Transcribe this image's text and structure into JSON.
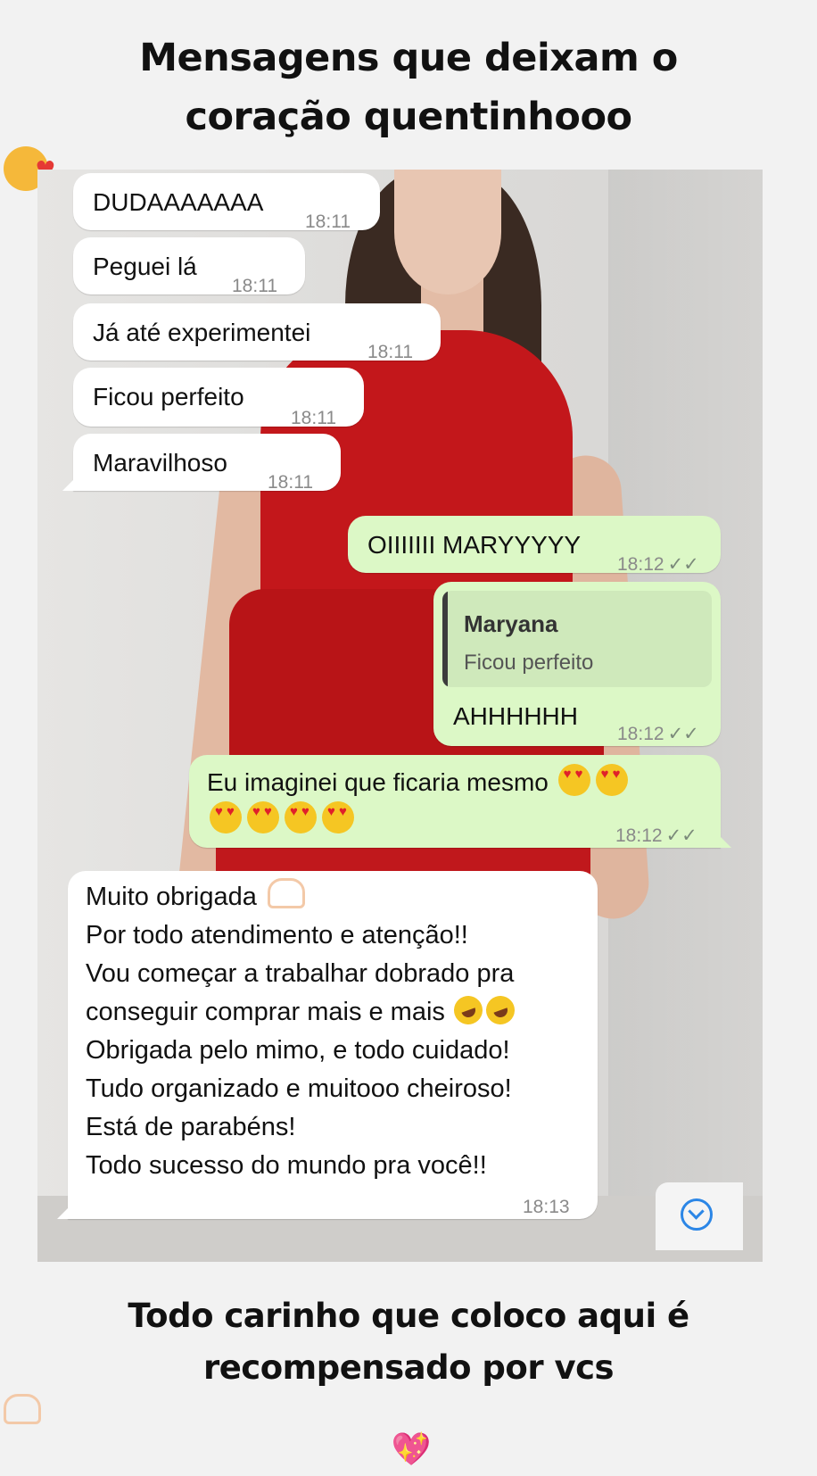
{
  "header": {
    "line1": "Mensagens que deixam o",
    "line2": "coração quentinhooo",
    "emoji": "smiling-face-with-hearts-icon"
  },
  "messages": {
    "m1": {
      "text": "DUDAAAAAAA",
      "time": "18:11"
    },
    "m2": {
      "text": "Peguei lá",
      "time": "18:11"
    },
    "m3": {
      "text": "Já até experimentei",
      "time": "18:11"
    },
    "m4": {
      "text": "Ficou perfeito",
      "time": "18:11"
    },
    "m5": {
      "text": "Maravilhoso",
      "time": "18:11"
    },
    "m6": {
      "text": "OIIIIIII MARYYYYY",
      "time": "18:12",
      "status": "read"
    },
    "m7": {
      "quote_name": "Maryana",
      "quote_text": "Ficou perfeito",
      "text": "AHHHHHH",
      "time": "18:12",
      "status": "read"
    },
    "m8": {
      "text": "Eu imaginei que ficaria mesmo",
      "time": "18:12",
      "status": "read",
      "emoji": "heart-eyes-icon"
    },
    "m9": {
      "lines": [
        "Muito obrigada",
        "Por todo atendimento e atenção!!",
        "Vou começar a trabalhar dobrado pra",
        "conseguir comprar mais e mais",
        "Obrigada pelo mimo, e todo cuidado!",
        "Tudo organizado e muitooo cheiroso!",
        "Está de parabéns!",
        "Todo sucesso do mundo pra você!!"
      ],
      "time": "18:13"
    }
  },
  "ticks_glyph": "✓✓",
  "footer": {
    "line1": "Todo carinho que coloco aqui é",
    "line2": "recompensado por vcs"
  },
  "colors": {
    "incoming_bubble": "#ffffff",
    "outgoing_bubble": "#dcf8c6",
    "dress": "#c3171b",
    "scroll_button": "#2b86e6"
  }
}
